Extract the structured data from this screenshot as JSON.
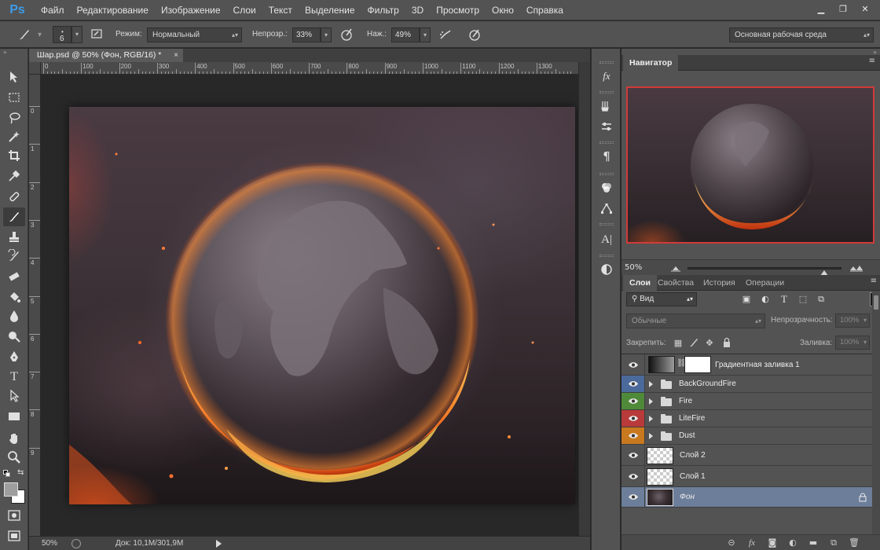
{
  "app": {
    "logo": "Ps"
  },
  "menu": [
    "Файл",
    "Редактирование",
    "Изображение",
    "Слои",
    "Текст",
    "Выделение",
    "Фильтр",
    "3D",
    "Просмотр",
    "Окно",
    "Справка"
  ],
  "window_controls": {
    "minimize": "▁",
    "restore": "❐",
    "close": "✕"
  },
  "options": {
    "brush_size": "6",
    "mode_label": "Режим:",
    "mode_value": "Нормальный",
    "opacity_label": "Непрозр.:",
    "opacity_value": "33%",
    "flow_label": "Наж.:",
    "flow_value": "49%",
    "workspace": "Основная рабочая среда"
  },
  "document": {
    "tab_title": "Шар.psd @ 50% (Фон, RGB/16) *",
    "close": "×",
    "ruler_top_labels": [
      "0",
      "100",
      "200",
      "300",
      "400",
      "500",
      "600",
      "700",
      "800",
      "900",
      "1000",
      "1100",
      "1200",
      "1300"
    ],
    "ruler_left_labels": [
      "0",
      "1",
      "2",
      "3",
      "4",
      "5",
      "6",
      "7",
      "8",
      "9"
    ]
  },
  "status": {
    "zoom": "50%",
    "doc_info": "Док: 10,1M/301,9M"
  },
  "navigator": {
    "title": "Навигатор",
    "zoom": "50%"
  },
  "layers_panel": {
    "tabs": [
      "Слои",
      "Свойства",
      "История",
      "Операции"
    ],
    "filter": "Вид",
    "blend_mode": "Обычные",
    "opacity_label": "Непрозрачность:",
    "opacity_value": "100%",
    "lock_label": "Закрепить:",
    "fill_label": "Заливка:",
    "fill_value": "100%",
    "layers": [
      {
        "name": "Градиентная заливка 1",
        "type": "fill",
        "color": ""
      },
      {
        "name": "BackGroundFire",
        "type": "group",
        "color": "#4b6a9b"
      },
      {
        "name": "Fire",
        "type": "group",
        "color": "#4f8a3a"
      },
      {
        "name": "LiteFire",
        "type": "group",
        "color": "#b83a3a"
      },
      {
        "name": "Dust",
        "type": "group",
        "color": "#c8781e"
      },
      {
        "name": "Слой 2",
        "type": "layer",
        "color": ""
      },
      {
        "name": "Слой 1",
        "type": "layer",
        "color": ""
      },
      {
        "name": "Фон",
        "type": "background",
        "color": ""
      }
    ]
  },
  "colors": {
    "accent_selected": "#6c7e99",
    "navigator_frame": "#d13a3a"
  }
}
